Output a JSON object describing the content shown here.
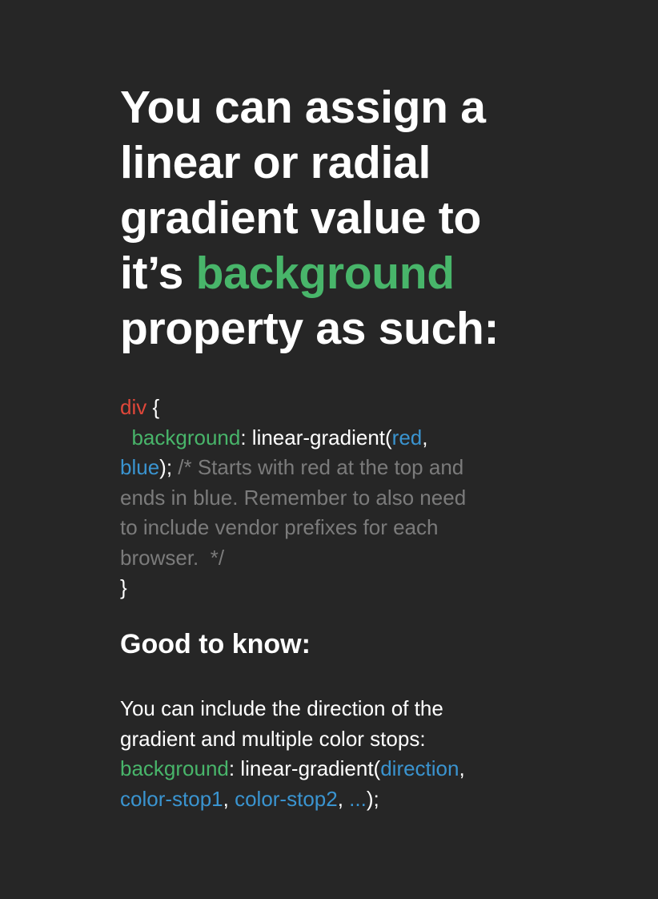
{
  "heading": {
    "line1": "You can assign a",
    "line2": "linear or radial",
    "line3": "gradient value to",
    "line4_pre": "it’s ",
    "line4_highlight": "background",
    "line5": "property as such:"
  },
  "code": {
    "selector": "div",
    "open_brace": " {",
    "indent": "  ",
    "property": "background",
    "colon_fn": ": linear-gradient(",
    "arg1": "red",
    "comma": ",",
    "arg2": "blue",
    "close": ");",
    "comment_line1": " /* Starts with red at the top and",
    "comment_line2": "ends in blue. Remember to also need",
    "comment_line3": "to include vendor prefixes for each",
    "comment_line4": "browser.  */",
    "close_brace": "}"
  },
  "good_to_know": {
    "title": "Good to know:",
    "line1": "You can include the direction of the",
    "line2": "gradient and multiple color stops:",
    "property": "background",
    "colon_fn": ": linear-gradient(",
    "arg_direction": "direction",
    "comma1": ",",
    "arg_stop1": "color-stop1",
    "comma2": ", ",
    "arg_stop2": "color-stop2",
    "comma3": ", ",
    "arg_more": "...",
    "close": ");"
  },
  "colors": {
    "background": "#262626",
    "property_green": "#48b56a",
    "selector_red": "#e0473a",
    "value_blue": "#3a94d0",
    "comment_gray": "#7b7b7b"
  }
}
